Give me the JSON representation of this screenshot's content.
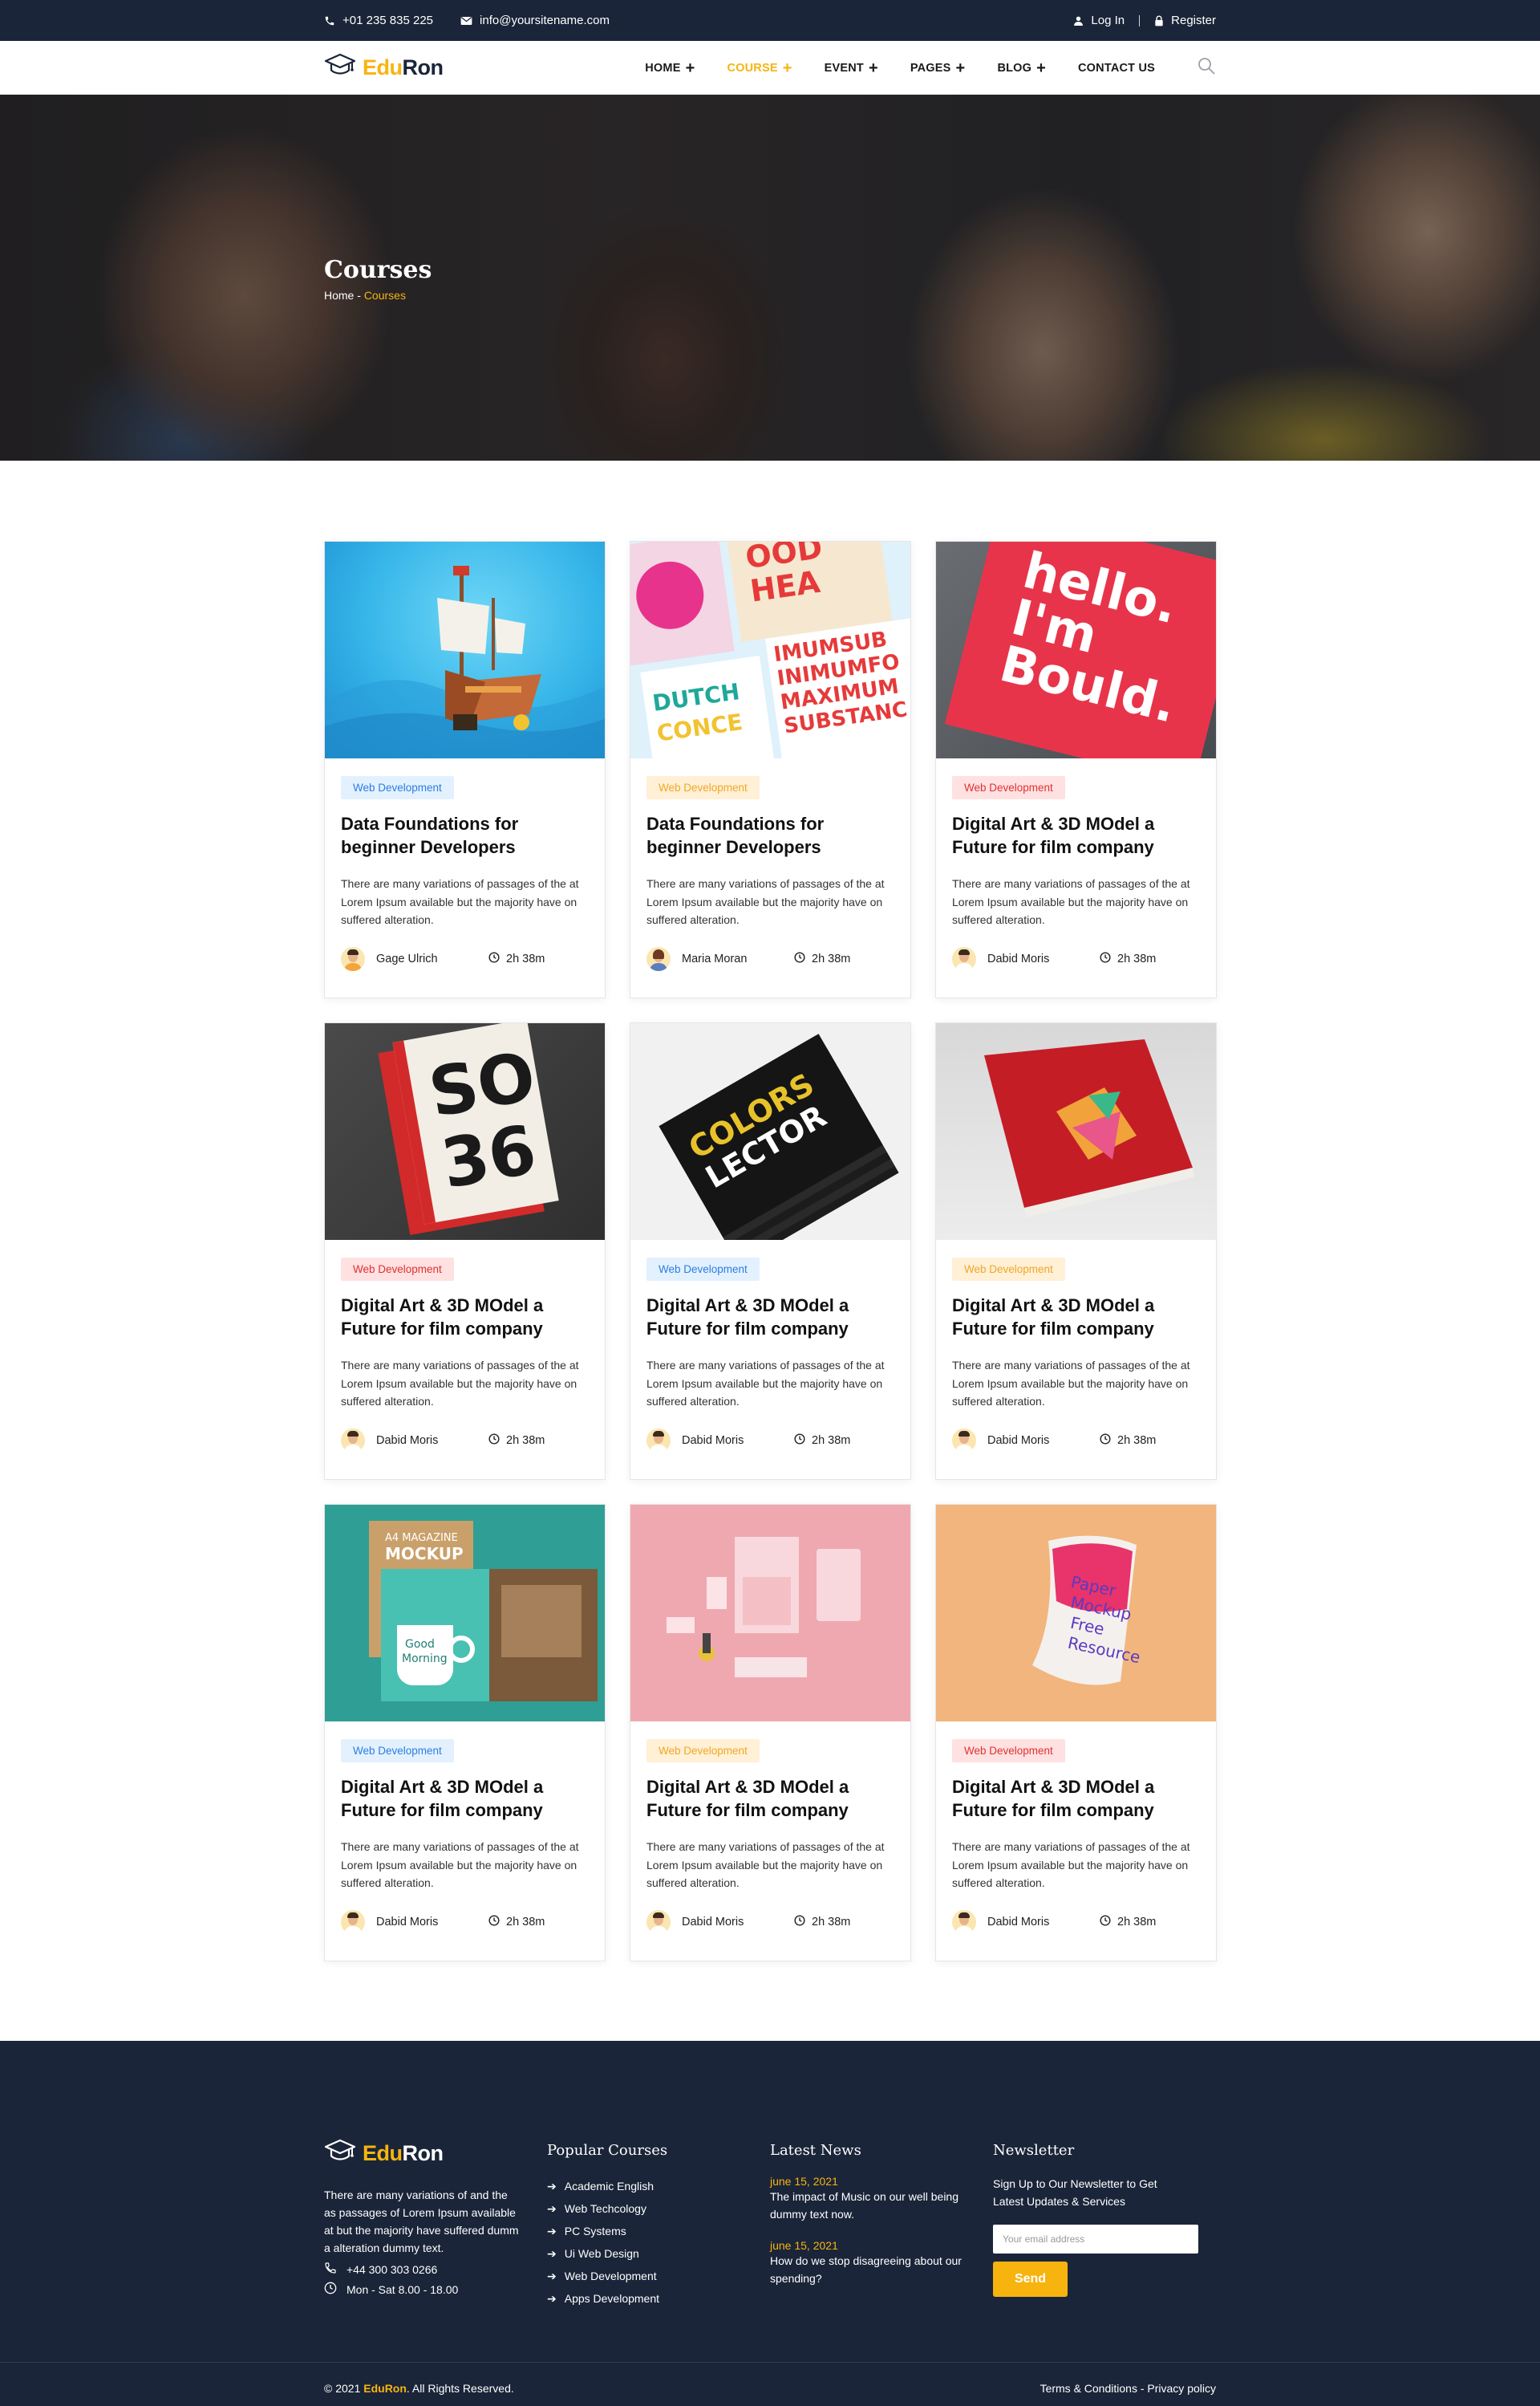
{
  "topbar": {
    "phone": "+01 235 835 225",
    "email": "info@yoursitename.com",
    "login": "Log In",
    "register": "Register"
  },
  "brand": {
    "part1": "Edu",
    "part2": "Ron"
  },
  "nav": [
    {
      "label": "HOME",
      "has_dropdown": true,
      "active": false
    },
    {
      "label": "COURSE",
      "has_dropdown": true,
      "active": true
    },
    {
      "label": "EVENT",
      "has_dropdown": true,
      "active": false
    },
    {
      "label": "PAGES",
      "has_dropdown": true,
      "active": false
    },
    {
      "label": "BLOG",
      "has_dropdown": true,
      "active": false
    },
    {
      "label": "CONTACT US",
      "has_dropdown": false,
      "active": false
    }
  ],
  "hero": {
    "title": "Courses",
    "breadcrumb_home": "Home",
    "breadcrumb_sep": " - ",
    "breadcrumb_current": "Courses"
  },
  "courses": [
    {
      "category": "Web Development",
      "badge_color": "blue",
      "title": "Data Foundations for beginner Developers",
      "desc": "There are many variations of passages of the at Lorem Ipsum available but the majority have on suffered alteration.",
      "author": "Gage Ulrich",
      "duration": "2h 38m",
      "thumb_icon": "pirate-ship-image"
    },
    {
      "category": "Web Development",
      "badge_color": "orange",
      "title": "Data Foundations for beginner Developers",
      "desc": "There are many variations of passages of the at Lorem Ipsum available but the majority have on suffered alteration.",
      "author": "Maria Moran",
      "duration": "2h 38m",
      "thumb_icon": "typography-posters-image"
    },
    {
      "category": "Web Development",
      "badge_color": "red",
      "title": "Digital Art & 3D MOdel a Future for film company",
      "desc": "There are many variations of passages of the at Lorem Ipsum available but the majority have on suffered alteration.",
      "author": "Dabid Moris",
      "duration": "2h 38m",
      "thumb_icon": "hello-im-bould-book-image"
    },
    {
      "category": "Web Development",
      "badge_color": "red",
      "title": "Digital Art & 3D MOdel a Future for film company",
      "desc": "There are many variations of passages of the at Lorem Ipsum available but the majority have on suffered alteration.",
      "author": "Dabid Moris",
      "duration": "2h 38m",
      "thumb_icon": "so-36-book-image"
    },
    {
      "category": "Web Development",
      "badge_color": "blue",
      "title": "Digital Art & 3D MOdel a Future for film company",
      "desc": "There are many variations of passages of the at Lorem Ipsum available but the majority have on suffered alteration.",
      "author": "Dabid Moris",
      "duration": "2h 38m",
      "thumb_icon": "colors-lector-books-image"
    },
    {
      "category": "Web Development",
      "badge_color": "orange",
      "title": "Digital Art & 3D MOdel a Future for film company",
      "desc": "There are many variations of passages of the at Lorem Ipsum available but the majority have on suffered alteration.",
      "author": "Dabid Moris",
      "duration": "2h 38m",
      "thumb_icon": "free-book-mockup-image"
    },
    {
      "category": "Web Development",
      "badge_color": "blue",
      "title": "Digital Art & 3D MOdel a Future for film company",
      "desc": "There are many variations of passages of the at Lorem Ipsum available but the majority have on suffered alteration.",
      "author": "Dabid Moris",
      "duration": "2h 38m",
      "thumb_icon": "magazine-mockup-image"
    },
    {
      "category": "Web Development",
      "badge_color": "orange",
      "title": "Digital Art & 3D MOdel a Future for film company",
      "desc": "There are many variations of passages of the at Lorem Ipsum available but the majority have on suffered alteration.",
      "author": "Dabid Moris",
      "duration": "2h 38m",
      "thumb_icon": "stationery-mockup-image"
    },
    {
      "category": "Web Development",
      "badge_color": "red",
      "title": "Digital Art & 3D MOdel a Future for film company",
      "desc": "There are many variations of passages of the at Lorem Ipsum available but the majority have on suffered alteration.",
      "author": "Dabid Moris",
      "duration": "2h 38m",
      "thumb_icon": "paper-mockup-image"
    }
  ],
  "thumb_texts": {
    "t3": [
      "hello.",
      "I'm",
      "Bould."
    ],
    "t4_top": "SO",
    "t4_bottom": "36",
    "t5": [
      "COLORS",
      "LECTOR"
    ],
    "t7_small": "A4 MAGAZINE",
    "t7_big": "MOCKUP",
    "t7_mug": [
      "Good",
      "Morning"
    ],
    "t9": [
      "Paper",
      "Mockup",
      "Free",
      "Resource"
    ]
  },
  "footer": {
    "about": "There are many variations of and the as passages of Lorem Ipsum available at but the majority have suffered dumm a alteration dummy text.",
    "phone": "+44 300 303 0266",
    "hours": "Mon - Sat 8.00 - 18.00",
    "popular_title": "Popular Courses",
    "popular": [
      "Academic English",
      "Web Techcology",
      "PC Systems",
      "Ui Web Design",
      "Web Development",
      "Apps Development"
    ],
    "news_title": "Latest News",
    "news": [
      {
        "date": "june 15, 2021",
        "title": "The impact of Music on our well being dummy text now."
      },
      {
        "date": "june 15, 2021",
        "title": "How do we stop disagreeing about our spending?"
      }
    ],
    "newsletter_title": "Newsletter",
    "newsletter_text": "Sign Up to Our Newsletter to Get Latest Updates & Services",
    "email_placeholder": "Your email address",
    "send_label": "Send",
    "copyright_prefix": "© 2021 ",
    "copyright_brand": "EduRon",
    "copyright_suffix": ". All Rights Reserved.",
    "terms": "Terms & Conditions",
    "links_sep": " - ",
    "privacy": "Privacy policy"
  },
  "colors": {
    "accent": "#f7b40f",
    "navy": "#1a2539",
    "badge_blue": "#2c7de0",
    "badge_orange": "#f0a726",
    "badge_red": "#e03131"
  }
}
